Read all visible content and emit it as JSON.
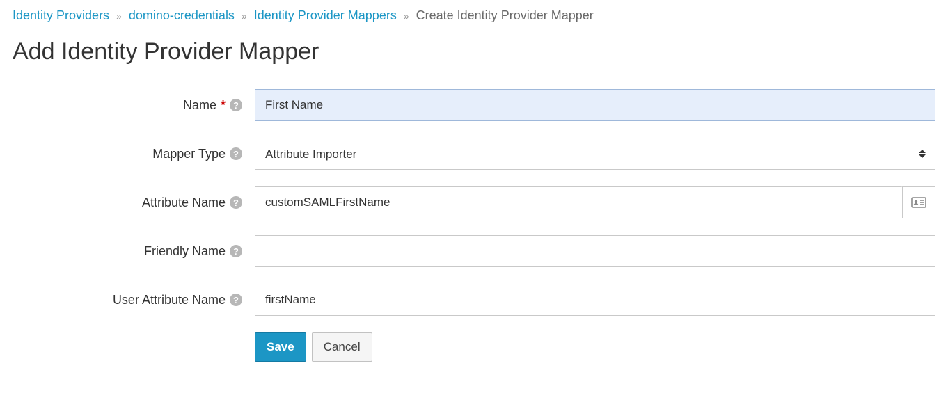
{
  "breadcrumb": {
    "items": [
      {
        "label": "Identity Providers",
        "link": true
      },
      {
        "label": "domino-credentials",
        "link": true
      },
      {
        "label": "Identity Provider Mappers",
        "link": true
      },
      {
        "label": "Create Identity Provider Mapper",
        "link": false
      }
    ]
  },
  "page": {
    "title": "Add Identity Provider Mapper"
  },
  "form": {
    "name": {
      "label": "Name",
      "required": true,
      "value": "First Name"
    },
    "mapperType": {
      "label": "Mapper Type",
      "value": "Attribute Importer"
    },
    "attributeName": {
      "label": "Attribute Name",
      "value": "customSAMLFirstName"
    },
    "friendlyName": {
      "label": "Friendly Name",
      "value": ""
    },
    "userAttributeName": {
      "label": "User Attribute Name",
      "value": "firstName"
    }
  },
  "buttons": {
    "save": "Save",
    "cancel": "Cancel"
  }
}
